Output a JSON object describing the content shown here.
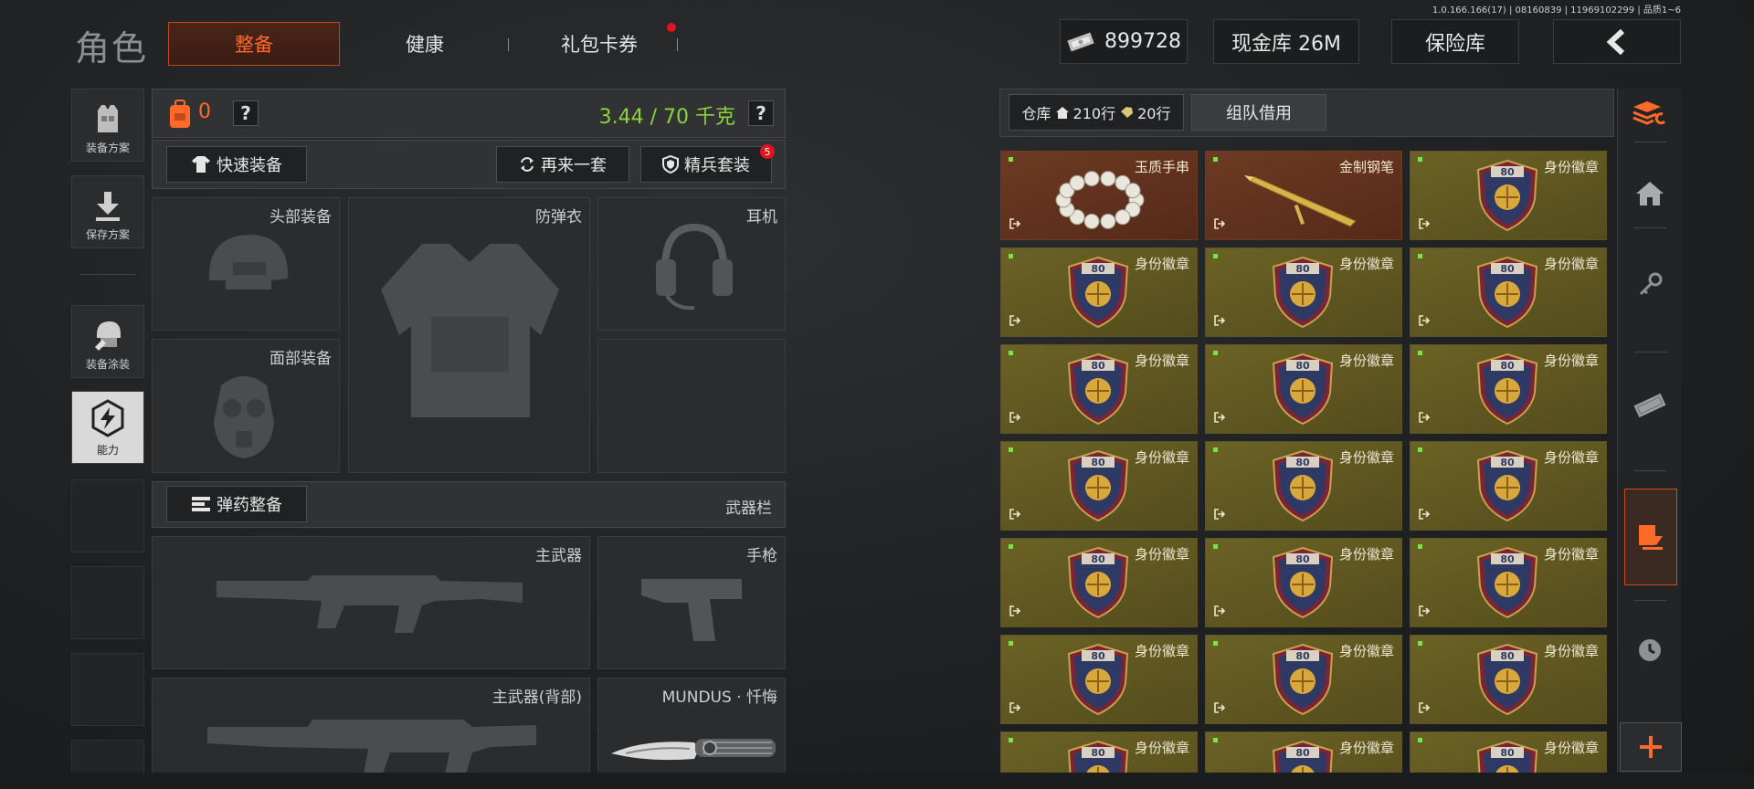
{
  "version_info": "1.0.166.166(17) | 08160839 | 11969102299 | 品质1~6",
  "header": {
    "title": "角色",
    "tabs": [
      {
        "label": "整备",
        "active": true
      },
      {
        "label": "健康",
        "active": false
      },
      {
        "label": "礼包卡券",
        "active": false,
        "notification": true
      }
    ],
    "currency_value": "899728",
    "cash_vault": "现金库 26M",
    "insurance_label": "保险库",
    "back_icon": "chevron-left-icon"
  },
  "left_nav": [
    {
      "label": "装备方案",
      "icon": "vest-icon"
    },
    {
      "label": "保存方案",
      "icon": "download-icon"
    },
    {
      "label": "装备涂装",
      "icon": "helmet-paint-icon"
    },
    {
      "label": "能力",
      "icon": "ability-icon",
      "active": true
    }
  ],
  "equipment": {
    "backpack_count": "0",
    "weight": "3.44 / 70 千克",
    "help": "?",
    "quick_equip": "快速装备",
    "again": "再来一套",
    "elite_set": "精兵套装",
    "elite_badge": "5",
    "slots": {
      "head": "头部装备",
      "armor": "防弹衣",
      "earphone": "耳机",
      "face": "面部装备"
    },
    "ammo_refit": "弹药整备",
    "weapon_bar": "武器栏",
    "weapons": {
      "primary": "主武器",
      "pistol": "手枪",
      "primary_back": "主武器(背部)",
      "melee": "MUNDUS · 忏悔"
    }
  },
  "stash": {
    "warehouse_label": "仓库",
    "warehouse_rows": "210行",
    "secondary_rows": "20行",
    "team_borrow": "组队借用",
    "items": [
      {
        "name": "玉质手串",
        "kind": "beads",
        "color": "brown"
      },
      {
        "name": "金制钢笔",
        "kind": "pen",
        "color": "brown"
      },
      {
        "name": "身份徽章",
        "kind": "badge",
        "color": "gold"
      },
      {
        "name": "身份徽章",
        "kind": "badge",
        "color": "gold"
      },
      {
        "name": "身份徽章",
        "kind": "badge",
        "color": "gold"
      },
      {
        "name": "身份徽章",
        "kind": "badge",
        "color": "gold"
      },
      {
        "name": "身份徽章",
        "kind": "badge",
        "color": "gold"
      },
      {
        "name": "身份徽章",
        "kind": "badge",
        "color": "gold"
      },
      {
        "name": "身份徽章",
        "kind": "badge",
        "color": "gold"
      },
      {
        "name": "身份徽章",
        "kind": "badge",
        "color": "gold"
      },
      {
        "name": "身份徽章",
        "kind": "badge",
        "color": "gold"
      },
      {
        "name": "身份徽章",
        "kind": "badge",
        "color": "gold"
      },
      {
        "name": "身份徽章",
        "kind": "badge",
        "color": "gold"
      },
      {
        "name": "身份徽章",
        "kind": "badge",
        "color": "gold"
      },
      {
        "name": "身份徽章",
        "kind": "badge",
        "color": "gold"
      },
      {
        "name": "身份徽章",
        "kind": "badge",
        "color": "gold"
      },
      {
        "name": "身份徽章",
        "kind": "badge",
        "color": "gold"
      },
      {
        "name": "身份徽章",
        "kind": "badge",
        "color": "gold"
      },
      {
        "name": "身份徽章",
        "kind": "badge",
        "color": "gold"
      },
      {
        "name": "身份徽章",
        "kind": "badge",
        "color": "gold"
      },
      {
        "name": "身份徽章",
        "kind": "badge",
        "color": "gold"
      }
    ],
    "badge_number": "80"
  },
  "right_rail": [
    {
      "icon": "sort-stack-icon",
      "accent": true
    },
    {
      "icon": "home-icon"
    },
    {
      "icon": "key-icon"
    },
    {
      "icon": "cash-icon"
    },
    {
      "icon": "inbox-down-icon",
      "active": true
    },
    {
      "icon": "clock-icon"
    },
    {
      "icon": "plus-icon",
      "accent": true
    }
  ],
  "colors": {
    "accent": "#ff6a2a",
    "weight_green": "#8dd23a",
    "item_gold": "#6b6226",
    "item_brown": "#6e3a22"
  }
}
